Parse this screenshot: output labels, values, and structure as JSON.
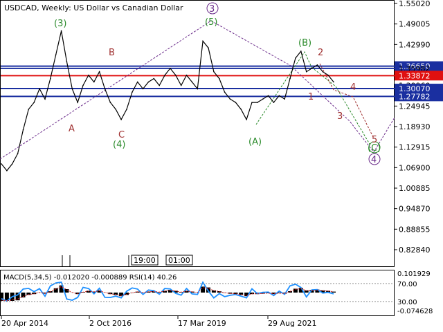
{
  "chart_title": "USDCAD, Weekly:  US Dollar vs Canadian Dollar",
  "colors": {
    "price": "#000000",
    "level_blue": "#1a2fa0",
    "level_red": "#e01010",
    "label_blue_bg": "#1a2fa0",
    "label_red_bg": "#e01010",
    "wave_green": "#2a8a2a",
    "wave_purple": "#6a2a8a",
    "wave_red": "#a03030",
    "macd_hist": "#000000",
    "macd_signal": "#e02020",
    "rsi_line": "#1e90ff"
  },
  "price_axis": {
    "ticks": [
      "1.55020",
      "1.49005",
      "1.42990",
      "1.36975",
      "1.30960",
      "1.24945",
      "1.18930",
      "1.12915",
      "1.06900",
      "1.00885",
      "0.94870",
      "0.88855",
      "0.82840"
    ],
    "tick_values": [
      1.5502,
      1.49005,
      1.4299,
      1.36975,
      1.3096,
      1.24945,
      1.1893,
      1.12915,
      1.069,
      1.00885,
      0.9487,
      0.88855,
      0.8284
    ],
    "ymin": 0.8284,
    "ymax": 1.5502
  },
  "time_axis": {
    "labels": [
      "20 Apr 2014",
      "2 Oct 2016",
      "17 Mar 2019",
      "29 Aug 2021"
    ]
  },
  "session_markers": [
    "19:00",
    "01:00"
  ],
  "levels": [
    {
      "label": "1.36650",
      "value": 1.3665,
      "color": "blue",
      "highlight": true
    },
    {
      "label": "1.35982",
      "value": 1.3598,
      "color": "blue",
      "highlight": false
    },
    {
      "label": "1.33872",
      "value": 1.3387,
      "color": "red",
      "highlight": true
    },
    {
      "label": "1.30070",
      "value": 1.3007,
      "color": "blue",
      "highlight": true
    },
    {
      "label": "1.27782",
      "value": 1.2778,
      "color": "blue",
      "highlight": true
    }
  ],
  "wave_labels": {
    "top_3_circled": "3",
    "wave_5_paren": "(5)",
    "wave_3_paren": "(3)",
    "wave_B_paren": "(B)",
    "wave_A_paren": "(A)",
    "wave_4_paren": "(4)",
    "wave_C_paren": "(C)",
    "bottom_4_circled": "4",
    "minor_B": "B",
    "minor_A": "A",
    "minor_C": "C",
    "minor_1": "1",
    "minor_2": "2",
    "minor_3": "3",
    "minor_4": "4",
    "minor_5": "5"
  },
  "indicator": {
    "label": "MACD(5,34,5) -0.012020 -0.000889 RSI(14) 40.26",
    "macd_axis": [
      "0.101929",
      "-0.074628"
    ],
    "rsi_axis": [
      "70.00",
      "30.00"
    ]
  },
  "chart_data": {
    "type": "line",
    "title": "USDCAD, Weekly:  US Dollar vs Canadian Dollar",
    "xlabel": "",
    "ylabel": "",
    "ylim": [
      0.8284,
      1.5502
    ],
    "grid": false,
    "x_tick_labels": [
      "20 Apr 2014",
      "2 Oct 2016",
      "17 Mar 2019",
      "29 Aug 2021"
    ],
    "series": [
      {
        "values": [
          1.08,
          1.06,
          1.08,
          1.11,
          1.18,
          1.24,
          1.26,
          1.3,
          1.27,
          1.33,
          1.4,
          1.47,
          1.38,
          1.3,
          1.26,
          1.31,
          1.34,
          1.32,
          1.35,
          1.3,
          1.26,
          1.24,
          1.21,
          1.24,
          1.29,
          1.32,
          1.3,
          1.32,
          1.33,
          1.31,
          1.34,
          1.36,
          1.34,
          1.31,
          1.34,
          1.32,
          1.3,
          1.44,
          1.42,
          1.35,
          1.33,
          1.29,
          1.27,
          1.26,
          1.24,
          1.21,
          1.26,
          1.26,
          1.27,
          1.28,
          1.26,
          1.28,
          1.27,
          1.33,
          1.39,
          1.41,
          1.35,
          1.36,
          1.37,
          1.35,
          1.34,
          1.32
        ]
      }
    ]
  }
}
